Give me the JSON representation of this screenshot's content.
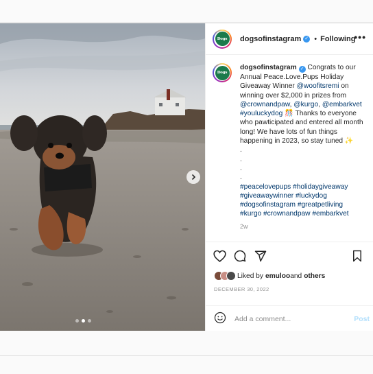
{
  "post": {
    "username": "dogsofinstagram",
    "verified": true,
    "separator": "•",
    "follow_status": "Following",
    "more_label": "•••",
    "avatar_text": "Dogs",
    "caption": {
      "username": "dogsofinstagram",
      "text_1": " Congrats to our Annual Peace.Love.Pups Holiday Giveaway Winner ",
      "mention_winner": "@woofitsremi",
      "text_2": " on winning over $2,000 in prizes from ",
      "mention_1": "@crownandpaw",
      "text_3": ", ",
      "mention_2": "@kurgo",
      "text_4": ",",
      "mention_3": "@embarkvet",
      "text_5": " ",
      "hashtag_lucky": "#youluckydog",
      "text_6": " 🎊 Thanks to everyone who pawticipated and entered all month long! We have lots of fun things happening in 2023, so stay tuned ✨",
      "dots": [
        ".",
        ".",
        ".",
        "."
      ],
      "hashtags_line_1": [
        "#peacelovepups",
        "#holidaygiveaway"
      ],
      "hashtags_line_2": [
        "#giveawaywinner",
        "#luckydog"
      ],
      "hashtags_line_3": [
        "#dogsofinstagram",
        "#greatpetliving"
      ],
      "hashtags_line_4": [
        "#kurgo",
        "#crownandpaw",
        "#embarkvet"
      ],
      "age": "2w"
    },
    "likes": {
      "prefix": "Liked by ",
      "first_user": "emuloo",
      "middle": " and ",
      "others": "others"
    },
    "date": "DECEMBER 30, 2022",
    "comment": {
      "placeholder": "Add a comment...",
      "post_label": "Post"
    },
    "carousel": {
      "slide_count": 3,
      "active_index": 1
    },
    "colors": {
      "link": "#00376b",
      "verified": "#3897f0",
      "post_button": "#b2dffc",
      "avatar_bg": "#1b7a4b"
    }
  }
}
